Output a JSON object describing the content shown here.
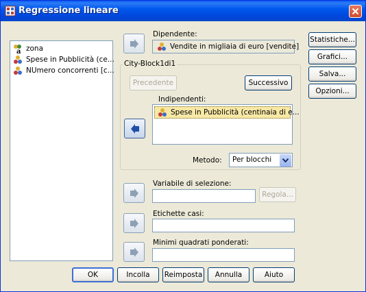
{
  "window": {
    "title": "Regressione lineare",
    "close_label": "×"
  },
  "variables_list": [
    {
      "label": "zona",
      "icon": "nominal-variable-icon"
    },
    {
      "label": "Spese in Pubblicità (ce...",
      "icon": "scale-variable-icon"
    },
    {
      "label": "NUmero concorrenti [c...",
      "icon": "scale-variable-icon"
    }
  ],
  "dependent": {
    "label": "Dipendente:",
    "value": "Vendite in migliaia di euro [vendite]"
  },
  "block": {
    "title": "City-Block1di1",
    "prev_label": "Precedente",
    "next_label": "Successivo"
  },
  "independents": {
    "label": "Indipendenti:",
    "items": [
      "Spese in Pubblicità (centinaia di e..."
    ]
  },
  "method": {
    "label": "Metodo:",
    "value": "Per blocchi"
  },
  "selection_var": {
    "label": "Variabile di selezione:",
    "value": "",
    "rule_label": "Regola..."
  },
  "case_labels": {
    "label": "Etichette casi:",
    "value": ""
  },
  "wls": {
    "label": "Minimi quadrati ponderati:",
    "value": ""
  },
  "side_buttons": [
    "Statistiche...",
    "Grafici...",
    "Salva...",
    "Opzioni..."
  ],
  "bottom_buttons": [
    "OK",
    "Incolla",
    "Reimposta",
    "Annulla",
    "Aiuto"
  ],
  "colors": {
    "titlebar": "#0054E3",
    "dialog_bg": "#ECE9D8",
    "selection": "#F7E8A6",
    "close": "#D04B2A"
  }
}
